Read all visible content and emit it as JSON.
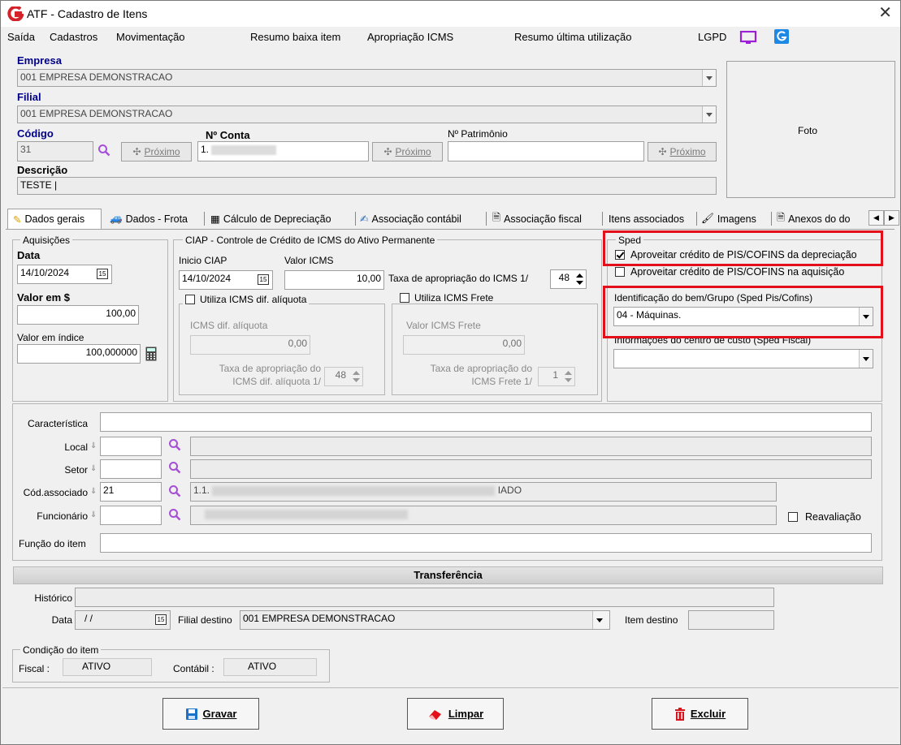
{
  "window": {
    "title": "ATF - Cadastro de Itens",
    "close": "✕"
  },
  "menu": [
    "Saída",
    "Cadastros",
    "Movimentação",
    "Resumo baixa item",
    "Apropriação ICMS",
    "Resumo última utilização",
    "LGPD"
  ],
  "header": {
    "empresa_label": "Empresa",
    "empresa_value": "001 EMPRESA DEMONSTRACAO",
    "filial_label": "Filial",
    "filial_value": "001 EMPRESA DEMONSTRACAO",
    "codigo_label": "Código",
    "codigo_value": "31",
    "conta_label": "Nº Conta",
    "conta_value": "1.",
    "patrimonio_label": "Nº Patrimônio",
    "patrimonio_value": "",
    "proximo_label": "Próximo",
    "descricao_label": "Descrição",
    "descricao_value": "TESTE |",
    "foto_label": "Foto"
  },
  "tabs": [
    "Dados gerais",
    "Dados - Frota",
    "Cálculo de Depreciação",
    "Associação contábil",
    "Associação fiscal",
    "Itens associados",
    "Imagens",
    "Anexos do do"
  ],
  "aquisicoes": {
    "title": "Aquisições",
    "data_label": "Data",
    "data_value": "14/10/2024",
    "valor_label": "Valor em $",
    "valor_value": "100,00",
    "indice_label": "Valor em índice",
    "indice_value": "100,000000"
  },
  "ciap": {
    "title": "CIAP - Controle de Crédito de ICMS do Ativo Permanente",
    "inicio_label": "Inicio CIAP",
    "inicio_value": "14/10/2024",
    "valor_icms_label": "Valor ICMS",
    "valor_icms_value": "10,00",
    "taxa_label": "Taxa de apropriação do ICMS 1/",
    "taxa_value": "48",
    "difal_check_label": "Utiliza ICMS dif. alíquota",
    "difal_label": "ICMS dif. alíquota",
    "difal_value": "0,00",
    "difal_taxa_label_1": "Taxa de apropriação do",
    "difal_taxa_label_2": "ICMS dif. alíquota 1/",
    "difal_taxa_value": "48",
    "frete_check_label": "Utiliza ICMS Frete",
    "frete_label": "Valor ICMS Frete",
    "frete_value": "0,00",
    "frete_taxa_label_1": "Taxa de apropriação do",
    "frete_taxa_label_2": "ICMS Frete 1/",
    "frete_taxa_value": "1"
  },
  "sped": {
    "title": "Sped",
    "check1_label": "Aproveitar crédito de PIS/COFINS da depreciação",
    "check1": true,
    "check2_label": "Aproveitar crédito de PIS/COFINS na aquisição",
    "check2": false,
    "ident_label": "Identificação do bem/Grupo (Sped Pis/Cofins)",
    "ident_value": "04 - Máquinas.",
    "centro_label": "Informações do centro de custo (Sped Fiscal)",
    "centro_value": ""
  },
  "detalhes": {
    "caracteristica_label": "Característica",
    "local_label": "Local",
    "setor_label": "Setor",
    "cod_assoc_label": "Cód.associado",
    "cod_assoc_value": "21",
    "cod_assoc_desc": "1.1.",
    "cod_assoc_desc_tail": "IADO",
    "funcionario_label": "Funcionário",
    "reavaliacao_label": "Reavaliação",
    "funcao_label": "Função do item"
  },
  "transferencia": {
    "title": "Transferência",
    "historico_label": "Histórico",
    "data_label": "Data",
    "data_value": "/ /",
    "filial_label": "Filial destino",
    "filial_value": "001 EMPRESA DEMONSTRACAO",
    "item_label": "Item destino"
  },
  "condicao": {
    "title": "Condição do item",
    "fiscal_label": "Fiscal :",
    "fiscal_value": "ATIVO",
    "contabil_label": "Contábil :",
    "contabil_value": "ATIVO"
  },
  "buttons": {
    "gravar": "Gravar",
    "limpar": "Limpar",
    "excluir": "Excluir"
  },
  "colors": {
    "highlight": "#e3101b",
    "label_blue": "#00008b",
    "lgpd_purple": "#9b1fd6",
    "logo_red": "#d3222a"
  }
}
